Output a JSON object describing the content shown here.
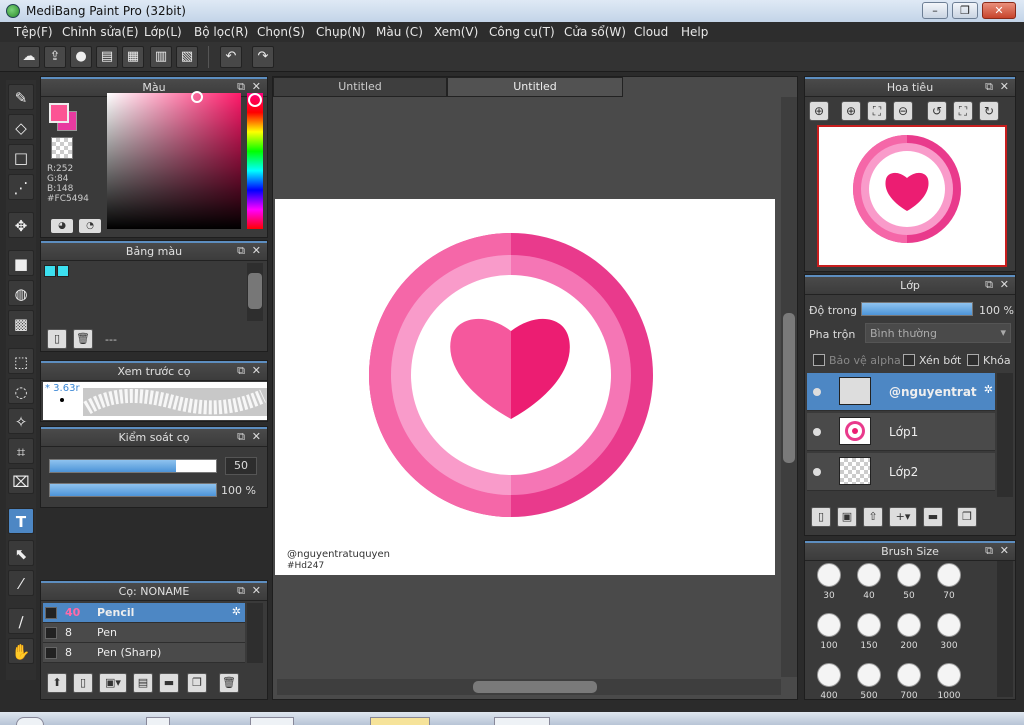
{
  "window": {
    "title": "MediBang Paint Pro (32bit)",
    "min": "–",
    "max": "❐",
    "close": "✕"
  },
  "menu": [
    "Tệp(F)",
    "Chỉnh sửa(E)",
    "Lớp(L)",
    "Bộ lọc(R)",
    "Chọn(S)",
    "Chụp(N)",
    "Màu (C)",
    "Xem(V)",
    "Công cụ(T)",
    "Cửa sổ(W)",
    "Cloud",
    "Help"
  ],
  "toolbar_icons": [
    "cloud-icon",
    "upload-icon",
    "speech-icon",
    "comment-icon",
    "document-icon",
    "grid-icon",
    "panel-icon",
    "undo-icon",
    "redo-icon"
  ],
  "tools": [
    "brush-icon",
    "eraser-icon",
    "rectangle-icon",
    "dot-brush-icon",
    "move-icon",
    "fill-rect-icon",
    "bucket-icon",
    "gradient-icon",
    "select-rect-icon",
    "lasso-icon",
    "magic-wand-icon",
    "select-pen-icon",
    "select-eraser-icon",
    "text-icon",
    "operation-icon",
    "eyedropper-icon",
    "pipette-icon",
    "hand-icon"
  ],
  "color_panel": {
    "title": "Màu",
    "fg_color": "#FC5494",
    "r": "R:252",
    "g": "G:84",
    "b": "B:148",
    "hex": "#FC5494"
  },
  "palette_panel": {
    "title": "Bảng màu",
    "footer_text": "---"
  },
  "brush_preview_panel": {
    "title": "Xem trước cọ",
    "size_label": "* 3.63r"
  },
  "brush_control_panel": {
    "title": "Kiểm soát cọ",
    "size_value": "50",
    "size_fraction": 0.76,
    "opacity_value": "100 %",
    "opacity_fraction": 1.0
  },
  "brush_list_panel": {
    "title": "Cọ: NONAME",
    "brushes": [
      {
        "size": "40",
        "name": "Pencil",
        "selected": true
      },
      {
        "size": "8",
        "name": "Pen",
        "selected": false
      },
      {
        "size": "8",
        "name": "Pen (Sharp)",
        "selected": false
      }
    ]
  },
  "document": {
    "tabs": [
      {
        "label": "Untitled",
        "active": false
      },
      {
        "label": "Untitled",
        "active": true
      }
    ],
    "watermark_user": "@nguyentratuquyen",
    "watermark_tag": "#Hd247"
  },
  "navigator_panel": {
    "title": "Hoa tiêu"
  },
  "layer_panel": {
    "title": "Lớp",
    "opacity_label": "Độ trong",
    "opacity_value": "100 %",
    "blend_label": "Pha trộn",
    "blend_value": "Bình thường",
    "protect_alpha": "Bảo vệ alpha",
    "clipping": "Xén bớt",
    "lock": "Khóa",
    "layers": [
      {
        "name": "@nguyentrat",
        "selected": true
      },
      {
        "name": "Lớp1",
        "selected": false
      },
      {
        "name": "Lớp2",
        "selected": false
      }
    ]
  },
  "brush_size_panel": {
    "title": "Brush Size",
    "sizes": [
      "30",
      "40",
      "50",
      "70",
      "100",
      "150",
      "200",
      "300",
      "400",
      "500",
      "700",
      "1000"
    ]
  }
}
